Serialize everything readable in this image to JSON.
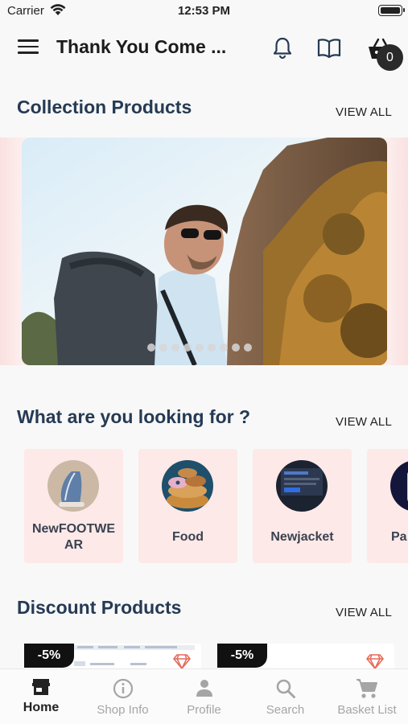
{
  "status_bar": {
    "carrier": "Carrier",
    "time": "12:53 PM"
  },
  "app_bar": {
    "title": "Thank You Come ...",
    "cart_count": "0"
  },
  "collection": {
    "title": "Collection Products",
    "view_all": "VIEW ALL",
    "slide_count": 9,
    "active_slide": 0
  },
  "categories": {
    "title": "What are you looking for ?",
    "view_all": "VIEW ALL",
    "items": [
      {
        "label": "NewFOOTWE\nAR",
        "icon": "shoe-image"
      },
      {
        "label": "Food",
        "icon": "donuts-image"
      },
      {
        "label": "Newjacket",
        "icon": "screen-image"
      },
      {
        "label": "Pa",
        "icon": "device-image"
      }
    ]
  },
  "discount": {
    "title": "Discount Products",
    "view_all": "VIEW ALL",
    "items": [
      {
        "badge": "-5%"
      },
      {
        "badge": "-5%"
      }
    ]
  },
  "tab_bar": {
    "active_color": "#222222",
    "inactive_color": "#a5a5a5",
    "items": [
      {
        "label": "Home",
        "icon": "store-icon",
        "active": true
      },
      {
        "label": "Shop Info",
        "icon": "info-icon",
        "active": false
      },
      {
        "label": "Profile",
        "icon": "person-icon",
        "active": false
      },
      {
        "label": "Search",
        "icon": "search-icon",
        "active": false
      },
      {
        "label": "Basket List",
        "icon": "cart-icon",
        "active": false
      }
    ]
  }
}
